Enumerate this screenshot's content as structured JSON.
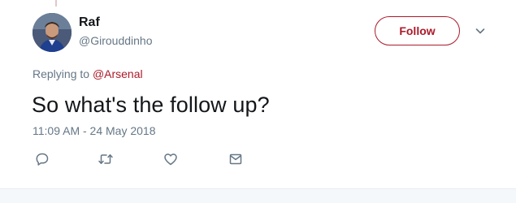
{
  "user": {
    "display_name": "Raf",
    "handle": "@Girouddinho",
    "follow_label": "Follow"
  },
  "tweet": {
    "replying_prefix": "Replying to",
    "replying_to": "@Arsenal",
    "text": "So what's the follow up?",
    "timestamp": "11:09 AM - 24 May 2018"
  },
  "icons": {
    "caret": "chevron-down-icon",
    "reply": "reply-icon",
    "retweet": "retweet-icon",
    "like": "heart-icon",
    "message": "envelope-icon"
  },
  "colors": {
    "accent": "#ab1a2a",
    "secondary_text": "#657786",
    "primary_text": "#14171a"
  }
}
